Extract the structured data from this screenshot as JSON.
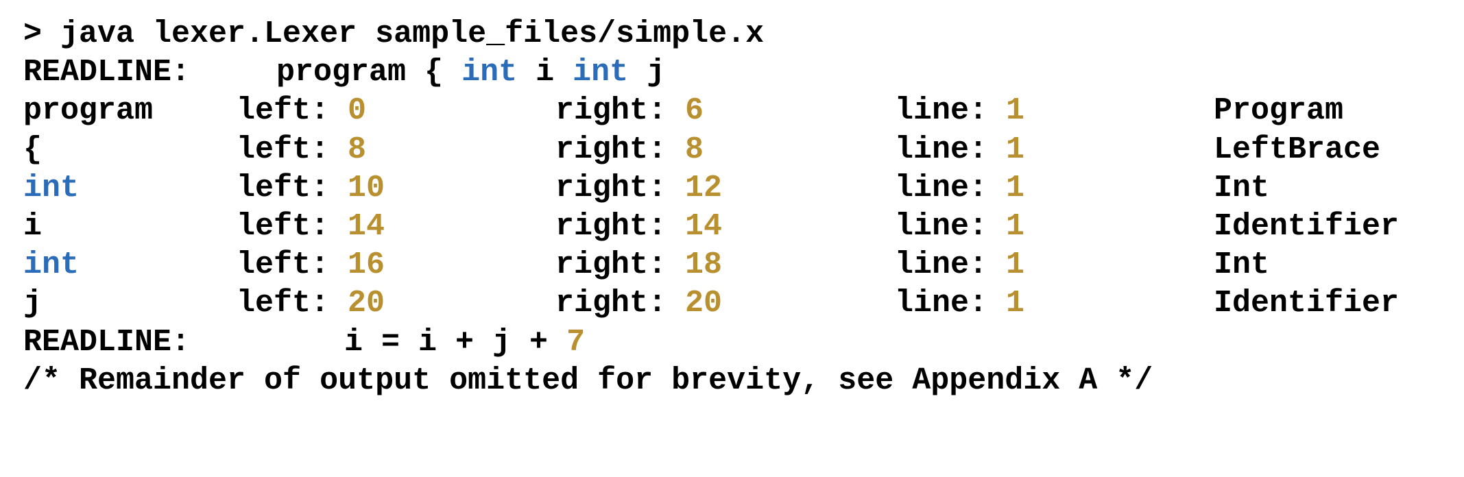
{
  "command": "> java lexer.Lexer sample_files/simple.x",
  "readline_label": "READLINE:",
  "readline1": [
    {
      "text": "program",
      "kind": "plain"
    },
    {
      "text": " ",
      "kind": "plain"
    },
    {
      "text": "{",
      "kind": "plain"
    },
    {
      "text": " ",
      "kind": "plain"
    },
    {
      "text": "int",
      "kind": "kw"
    },
    {
      "text": " ",
      "kind": "plain"
    },
    {
      "text": "i",
      "kind": "plain"
    },
    {
      "text": " ",
      "kind": "plain"
    },
    {
      "text": "int",
      "kind": "kw"
    },
    {
      "text": " ",
      "kind": "plain"
    },
    {
      "text": "j",
      "kind": "plain"
    }
  ],
  "labels": {
    "left": "left: ",
    "right": "right: ",
    "line": "line: "
  },
  "tokens": [
    {
      "lexeme": "program",
      "kind": "plain",
      "left": "0",
      "right": "6",
      "line": "1",
      "type": "Program"
    },
    {
      "lexeme": "{",
      "kind": "plain",
      "left": "8",
      "right": "8",
      "line": "1",
      "type": "LeftBrace"
    },
    {
      "lexeme": "int",
      "kind": "kw",
      "left": "10",
      "right": "12",
      "line": "1",
      "type": "Int"
    },
    {
      "lexeme": "i",
      "kind": "plain",
      "left": "14",
      "right": "14",
      "line": "1",
      "type": "Identifier"
    },
    {
      "lexeme": "int",
      "kind": "kw",
      "left": "16",
      "right": "18",
      "line": "1",
      "type": "Int"
    },
    {
      "lexeme": "j",
      "kind": "plain",
      "left": "20",
      "right": "20",
      "line": "1",
      "type": "Identifier"
    }
  ],
  "readline2": [
    {
      "text": "i = i + j + ",
      "kind": "plain"
    },
    {
      "text": "7",
      "kind": "num"
    }
  ],
  "footer_comment": "/* Remainder of output omitted for brevity, see Appendix A */",
  "colors": {
    "keyword": "#2b6cb8",
    "number": "#b8902f",
    "text": "#000000"
  }
}
